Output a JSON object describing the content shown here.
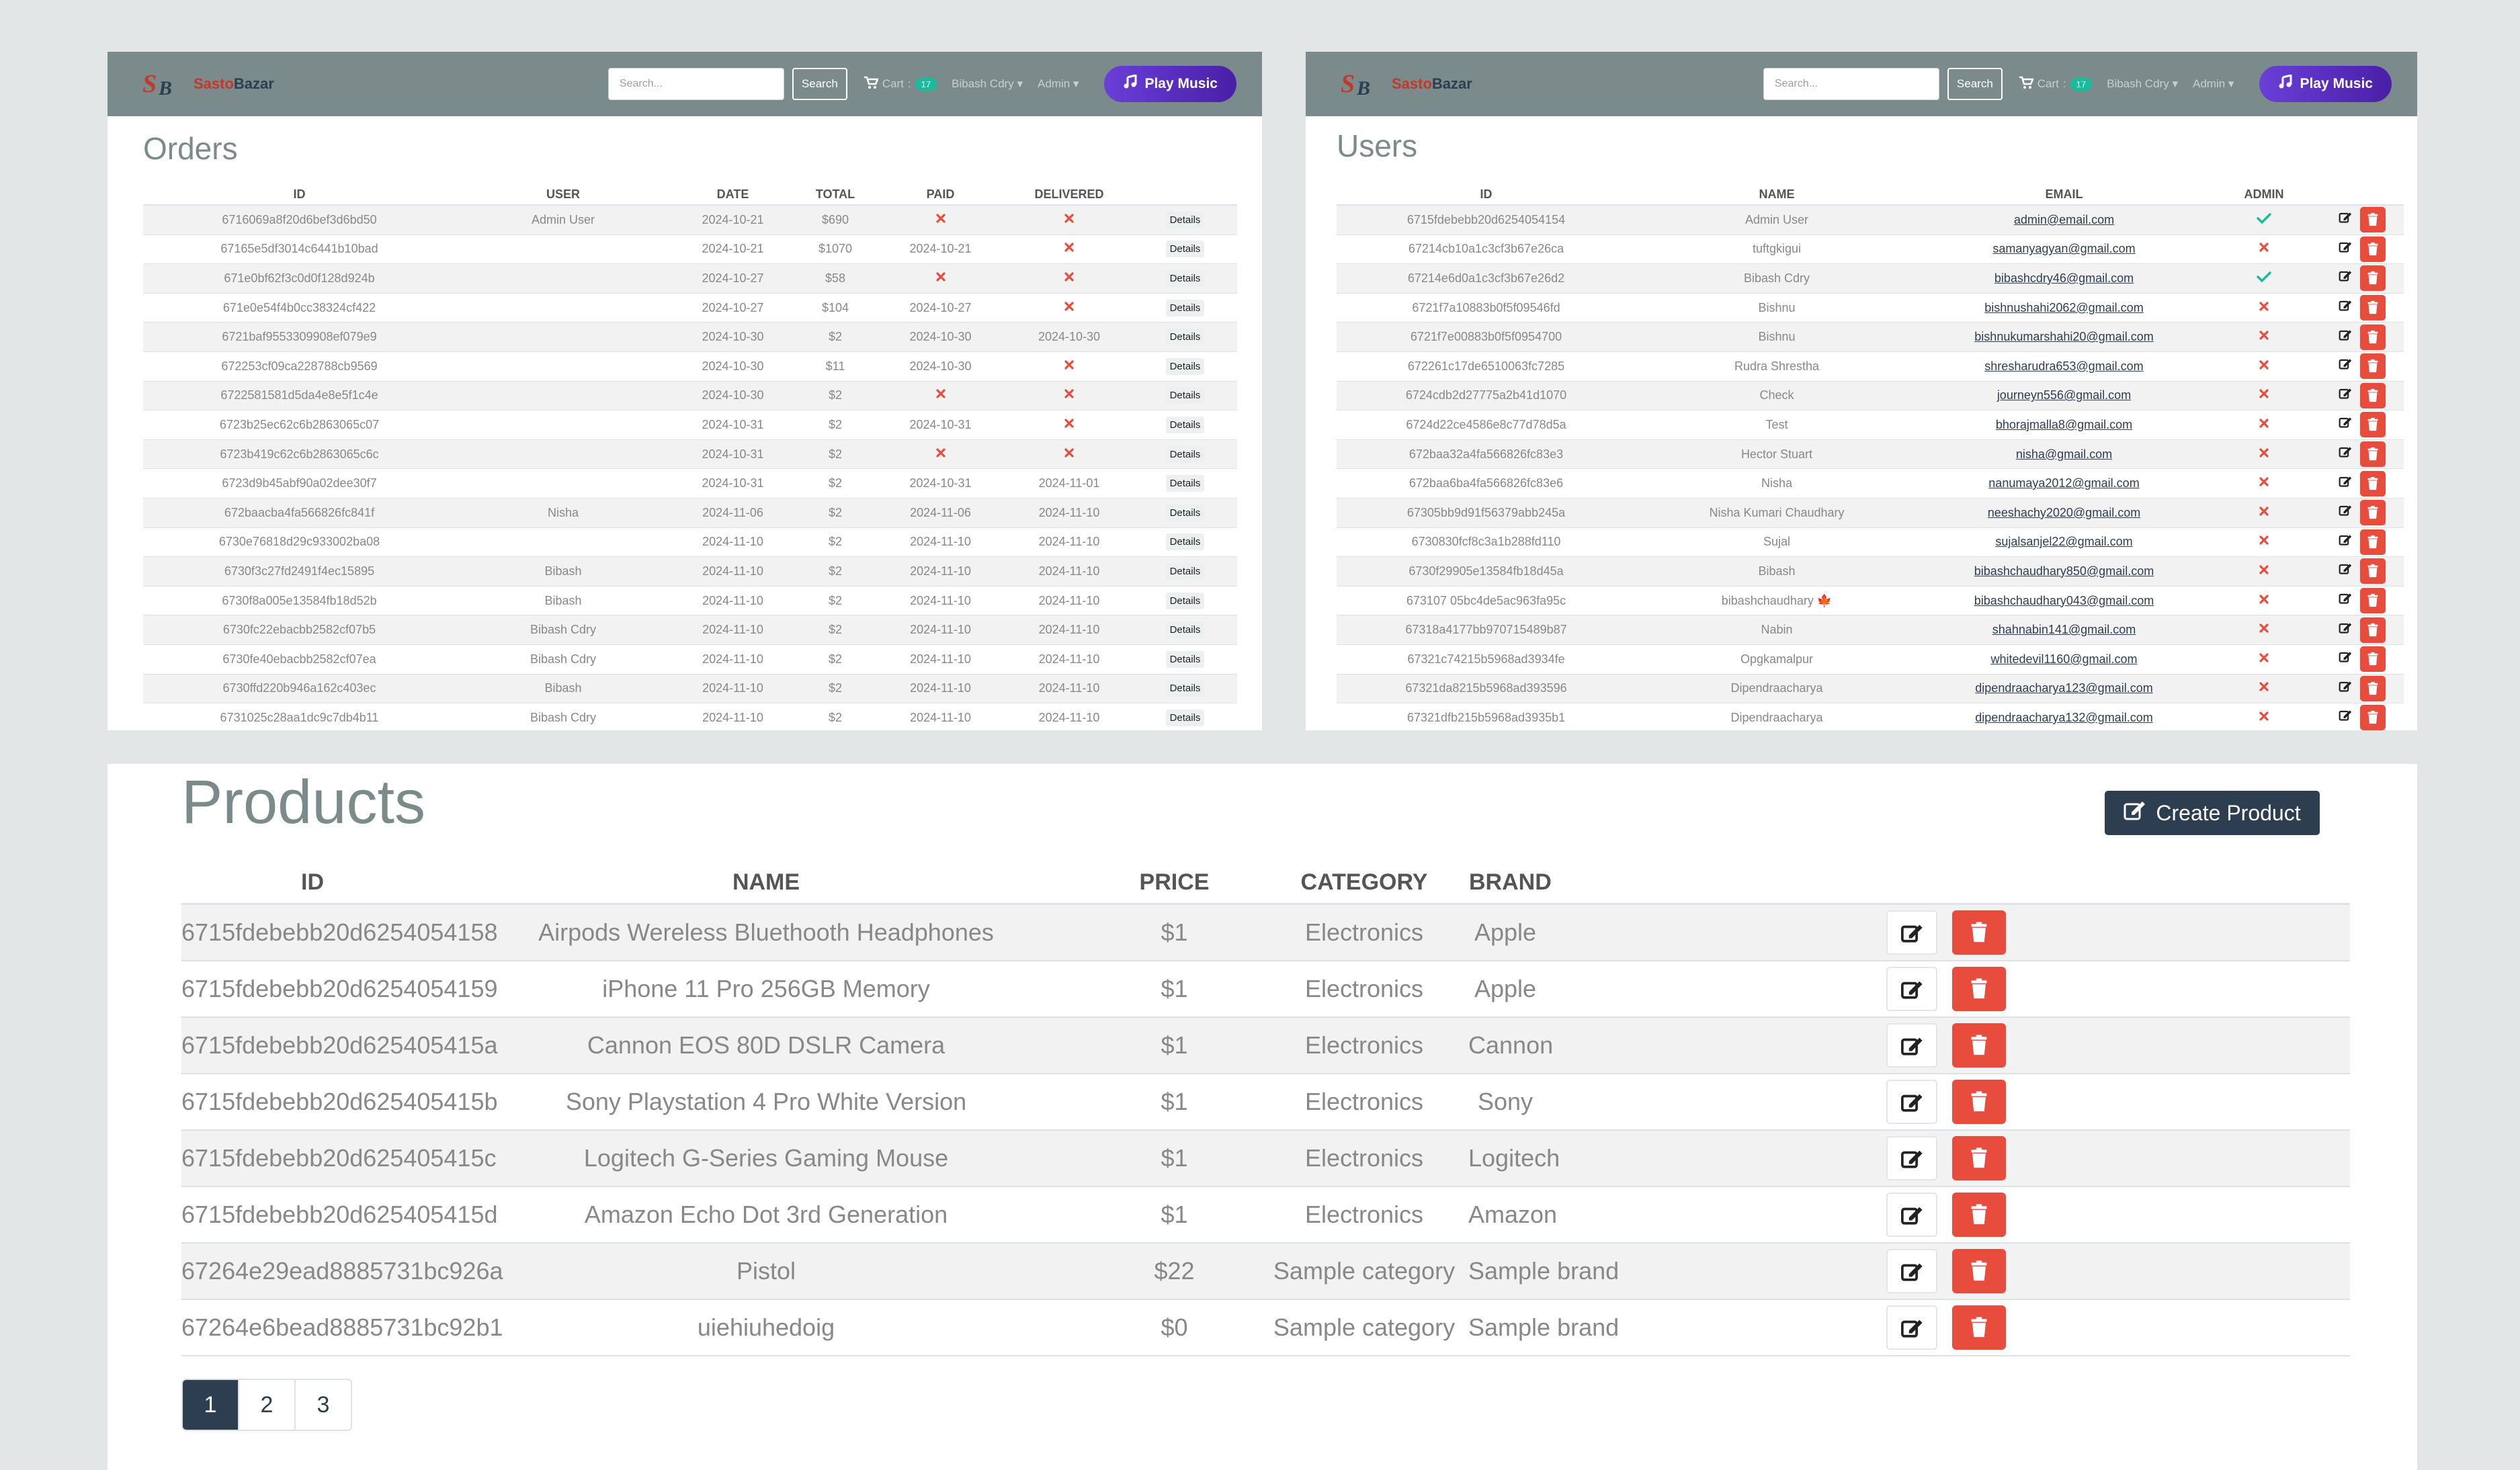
{
  "navbar": {
    "brand_prefix": "Sasto",
    "brand_suffix": "Bazar",
    "search_placeholder": "Search...",
    "search_button": "Search",
    "cart_label": "Cart",
    "cart_count": "17",
    "user_menu": "Bibash Cdry",
    "admin_menu": "Admin",
    "play_music": "Play Music"
  },
  "orders": {
    "title": "Orders",
    "columns": [
      "ID",
      "USER",
      "DATE",
      "TOTAL",
      "PAID",
      "DELIVERED",
      ""
    ],
    "rows": [
      {
        "id": "6716069a8f20d6bef3d6bd50",
        "user": "Admin User",
        "date": "2024-10-21",
        "total": "$690",
        "paid": "",
        "delivered": "",
        "details": "Details"
      },
      {
        "id": "67165e5df3014c6441b10bad",
        "user": "",
        "date": "2024-10-21",
        "total": "$1070",
        "paid": "2024-10-21",
        "delivered": "",
        "details": "Details"
      },
      {
        "id": "671e0bf62f3c0d0f128d924b",
        "user": "",
        "date": "2024-10-27",
        "total": "$58",
        "paid": "",
        "delivered": "",
        "details": "Details"
      },
      {
        "id": "671e0e54f4b0cc38324cf422",
        "user": "",
        "date": "2024-10-27",
        "total": "$104",
        "paid": "2024-10-27",
        "delivered": "",
        "details": "Details"
      },
      {
        "id": "6721baf9553309908ef079e9",
        "user": "",
        "date": "2024-10-30",
        "total": "$2",
        "paid": "2024-10-30",
        "delivered": "2024-10-30",
        "details": "Details"
      },
      {
        "id": "672253cf09ca228788cb9569",
        "user": "",
        "date": "2024-10-30",
        "total": "$11",
        "paid": "2024-10-30",
        "delivered": "",
        "details": "Details"
      },
      {
        "id": "6722581581d5da4e8e5f1c4e",
        "user": "",
        "date": "2024-10-30",
        "total": "$2",
        "paid": "",
        "delivered": "",
        "details": "Details"
      },
      {
        "id": "6723b25ec62c6b2863065c07",
        "user": "",
        "date": "2024-10-31",
        "total": "$2",
        "paid": "2024-10-31",
        "delivered": "",
        "details": "Details"
      },
      {
        "id": "6723b419c62c6b2863065c6c",
        "user": "",
        "date": "2024-10-31",
        "total": "$2",
        "paid": "",
        "delivered": "",
        "details": "Details"
      },
      {
        "id": "6723d9b45abf90a02dee30f7",
        "user": "",
        "date": "2024-10-31",
        "total": "$2",
        "paid": "2024-10-31",
        "delivered": "2024-11-01",
        "details": "Details"
      },
      {
        "id": "672baacba4fa566826fc841f",
        "user": "Nisha",
        "date": "2024-11-06",
        "total": "$2",
        "paid": "2024-11-06",
        "delivered": "2024-11-10",
        "details": "Details"
      },
      {
        "id": "6730e76818d29c933002ba08",
        "user": "",
        "date": "2024-11-10",
        "total": "$2",
        "paid": "2024-11-10",
        "delivered": "2024-11-10",
        "details": "Details"
      },
      {
        "id": "6730f3c27fd2491f4ec15895",
        "user": "Bibash",
        "date": "2024-11-10",
        "total": "$2",
        "paid": "2024-11-10",
        "delivered": "2024-11-10",
        "details": "Details"
      },
      {
        "id": "6730f8a005e13584fb18d52b",
        "user": "Bibash",
        "date": "2024-11-10",
        "total": "$2",
        "paid": "2024-11-10",
        "delivered": "2024-11-10",
        "details": "Details"
      },
      {
        "id": "6730fc22ebacbb2582cf07b5",
        "user": "Bibash Cdry",
        "date": "2024-11-10",
        "total": "$2",
        "paid": "2024-11-10",
        "delivered": "2024-11-10",
        "details": "Details"
      },
      {
        "id": "6730fe40ebacbb2582cf07ea",
        "user": "Bibash Cdry",
        "date": "2024-11-10",
        "total": "$2",
        "paid": "2024-11-10",
        "delivered": "2024-11-10",
        "details": "Details"
      },
      {
        "id": "6730ffd220b946a162c403ec",
        "user": "Bibash",
        "date": "2024-11-10",
        "total": "$2",
        "paid": "2024-11-10",
        "delivered": "2024-11-10",
        "details": "Details"
      },
      {
        "id": "6731025c28aa1dc9c7db4b11",
        "user": "Bibash Cdry",
        "date": "2024-11-10",
        "total": "$2",
        "paid": "2024-11-10",
        "delivered": "2024-11-10",
        "details": "Details"
      }
    ]
  },
  "users": {
    "title": "Users",
    "columns": [
      "ID",
      "NAME",
      "EMAIL",
      "ADMIN",
      ""
    ],
    "rows": [
      {
        "id": "6715fdebebb20d6254054154",
        "name": "Admin User",
        "email": "admin@email.com",
        "admin": true
      },
      {
        "id": "67214cb10a1c3cf3b67e26ca",
        "name": "tuftgkigui",
        "email": "samanyagyan@gmail.com",
        "admin": false
      },
      {
        "id": "67214e6d0a1c3cf3b67e26d2",
        "name": "Bibash Cdry",
        "email": "bibashcdry46@gmail.com",
        "admin": true
      },
      {
        "id": "6721f7a10883b0f5f09546fd",
        "name": "Bishnu",
        "email": "bishnushahi2062@gmail.com",
        "admin": false
      },
      {
        "id": "6721f7e00883b0f5f0954700",
        "name": "Bishnu",
        "email": "bishnukumarshahi20@gmail.com",
        "admin": false
      },
      {
        "id": "672261c17de6510063fc7285",
        "name": "Rudra Shrestha",
        "email": "shresharudra653@gmail.com",
        "admin": false
      },
      {
        "id": "6724cdb2d27775a2b41d1070",
        "name": "Check",
        "email": "journeyn556@gmail.com",
        "admin": false
      },
      {
        "id": "6724d22ce4586e8c77d78d5a",
        "name": "Test",
        "email": "bhorajmalla8@gmail.com",
        "admin": false
      },
      {
        "id": "672baa32a4fa566826fc83e3",
        "name": "Hector Stuart",
        "email": "nisha@gmail.com",
        "admin": false
      },
      {
        "id": "672baa6ba4fa566826fc83e6",
        "name": "Nisha",
        "email": "nanumaya2012@gmail.com",
        "admin": false
      },
      {
        "id": "67305bb9d91f56379abb245a",
        "name": "Nisha Kumari Chaudhary",
        "email": "neeshachy2020@gmail.com",
        "admin": false
      },
      {
        "id": "6730830fcf8c3a1b288fd110",
        "name": "Sujal",
        "email": "sujalsanjel22@gmail.com",
        "admin": false
      },
      {
        "id": "6730f29905e13584fb18d45a",
        "name": "Bibash",
        "email": "bibashchaudhary850@gmail.com",
        "admin": false
      },
      {
        "id": "673107 05bc4de5ac963fa95c",
        "name": "bibashchaudhary 🍁",
        "email": "bibashchaudhary043@gmail.com",
        "admin": false
      },
      {
        "id": "67318a4177bb970715489b87",
        "name": "Nabin",
        "email": "shahnabin141@gmail.com",
        "admin": false
      },
      {
        "id": "67321c74215b5968ad3934fe",
        "name": "Opgkamalpur",
        "email": "whitedevil1160@gmail.com",
        "admin": false
      },
      {
        "id": "67321da8215b5968ad393596",
        "name": "Dipendraacharya",
        "email": "dipendraacharya123@gmail.com",
        "admin": false
      },
      {
        "id": "67321dfb215b5968ad3935b1",
        "name": "Dipendraacharya",
        "email": "dipendraacharya132@gmail.com",
        "admin": false
      }
    ]
  },
  "products": {
    "title": "Products",
    "create_button": "Create Product",
    "columns": [
      "ID",
      "NAME",
      "PRICE",
      "CATEGORY",
      "BRAND",
      ""
    ],
    "rows": [
      {
        "id": "6715fdebebb20d6254054158",
        "name": "Airpods Wereless Bluethooth Headphones",
        "price": "$1",
        "category": "Electronics",
        "brand": "Apple"
      },
      {
        "id": "6715fdebebb20d6254054159",
        "name": "iPhone 11 Pro 256GB Memory",
        "price": "$1",
        "category": "Electronics",
        "brand": "Apple"
      },
      {
        "id": "6715fdebebb20d625405415a",
        "name": "Cannon EOS 80D DSLR Camera",
        "price": "$1",
        "category": "Electronics",
        "brand": "Cannon"
      },
      {
        "id": "6715fdebebb20d625405415b",
        "name": "Sony Playstation 4 Pro White Version",
        "price": "$1",
        "category": "Electronics",
        "brand": "Sony"
      },
      {
        "id": "6715fdebebb20d625405415c",
        "name": "Logitech G-Series Gaming Mouse",
        "price": "$1",
        "category": "Electronics",
        "brand": "Logitech"
      },
      {
        "id": "6715fdebebb20d625405415d",
        "name": "Amazon Echo Dot 3rd Generation",
        "price": "$1",
        "category": "Electronics",
        "brand": "Amazon"
      },
      {
        "id": "67264e29ead8885731bc926a",
        "name": "Pistol",
        "price": "$22",
        "category": "Sample category",
        "brand": "Sample brand"
      },
      {
        "id": "67264e6bead8885731bc92b1",
        "name": "uiehiuhedoig",
        "price": "$0",
        "category": "Sample category",
        "brand": "Sample brand"
      }
    ],
    "pagination": [
      "1",
      "2",
      "3"
    ],
    "active_page": "1"
  },
  "colors": {
    "navbar": "#7b8a8b",
    "primary": "#2c3e50",
    "danger": "#e74c3c",
    "success": "#18bc9c",
    "play_gradient_start": "#6a3fd8",
    "play_gradient_end": "#4a1fa6"
  },
  "icons": {
    "cart": "cart-icon",
    "music": "music-note-icon",
    "edit": "edit-icon",
    "delete": "trash-icon",
    "not_paid": "x-icon",
    "is_admin": "check-icon"
  }
}
